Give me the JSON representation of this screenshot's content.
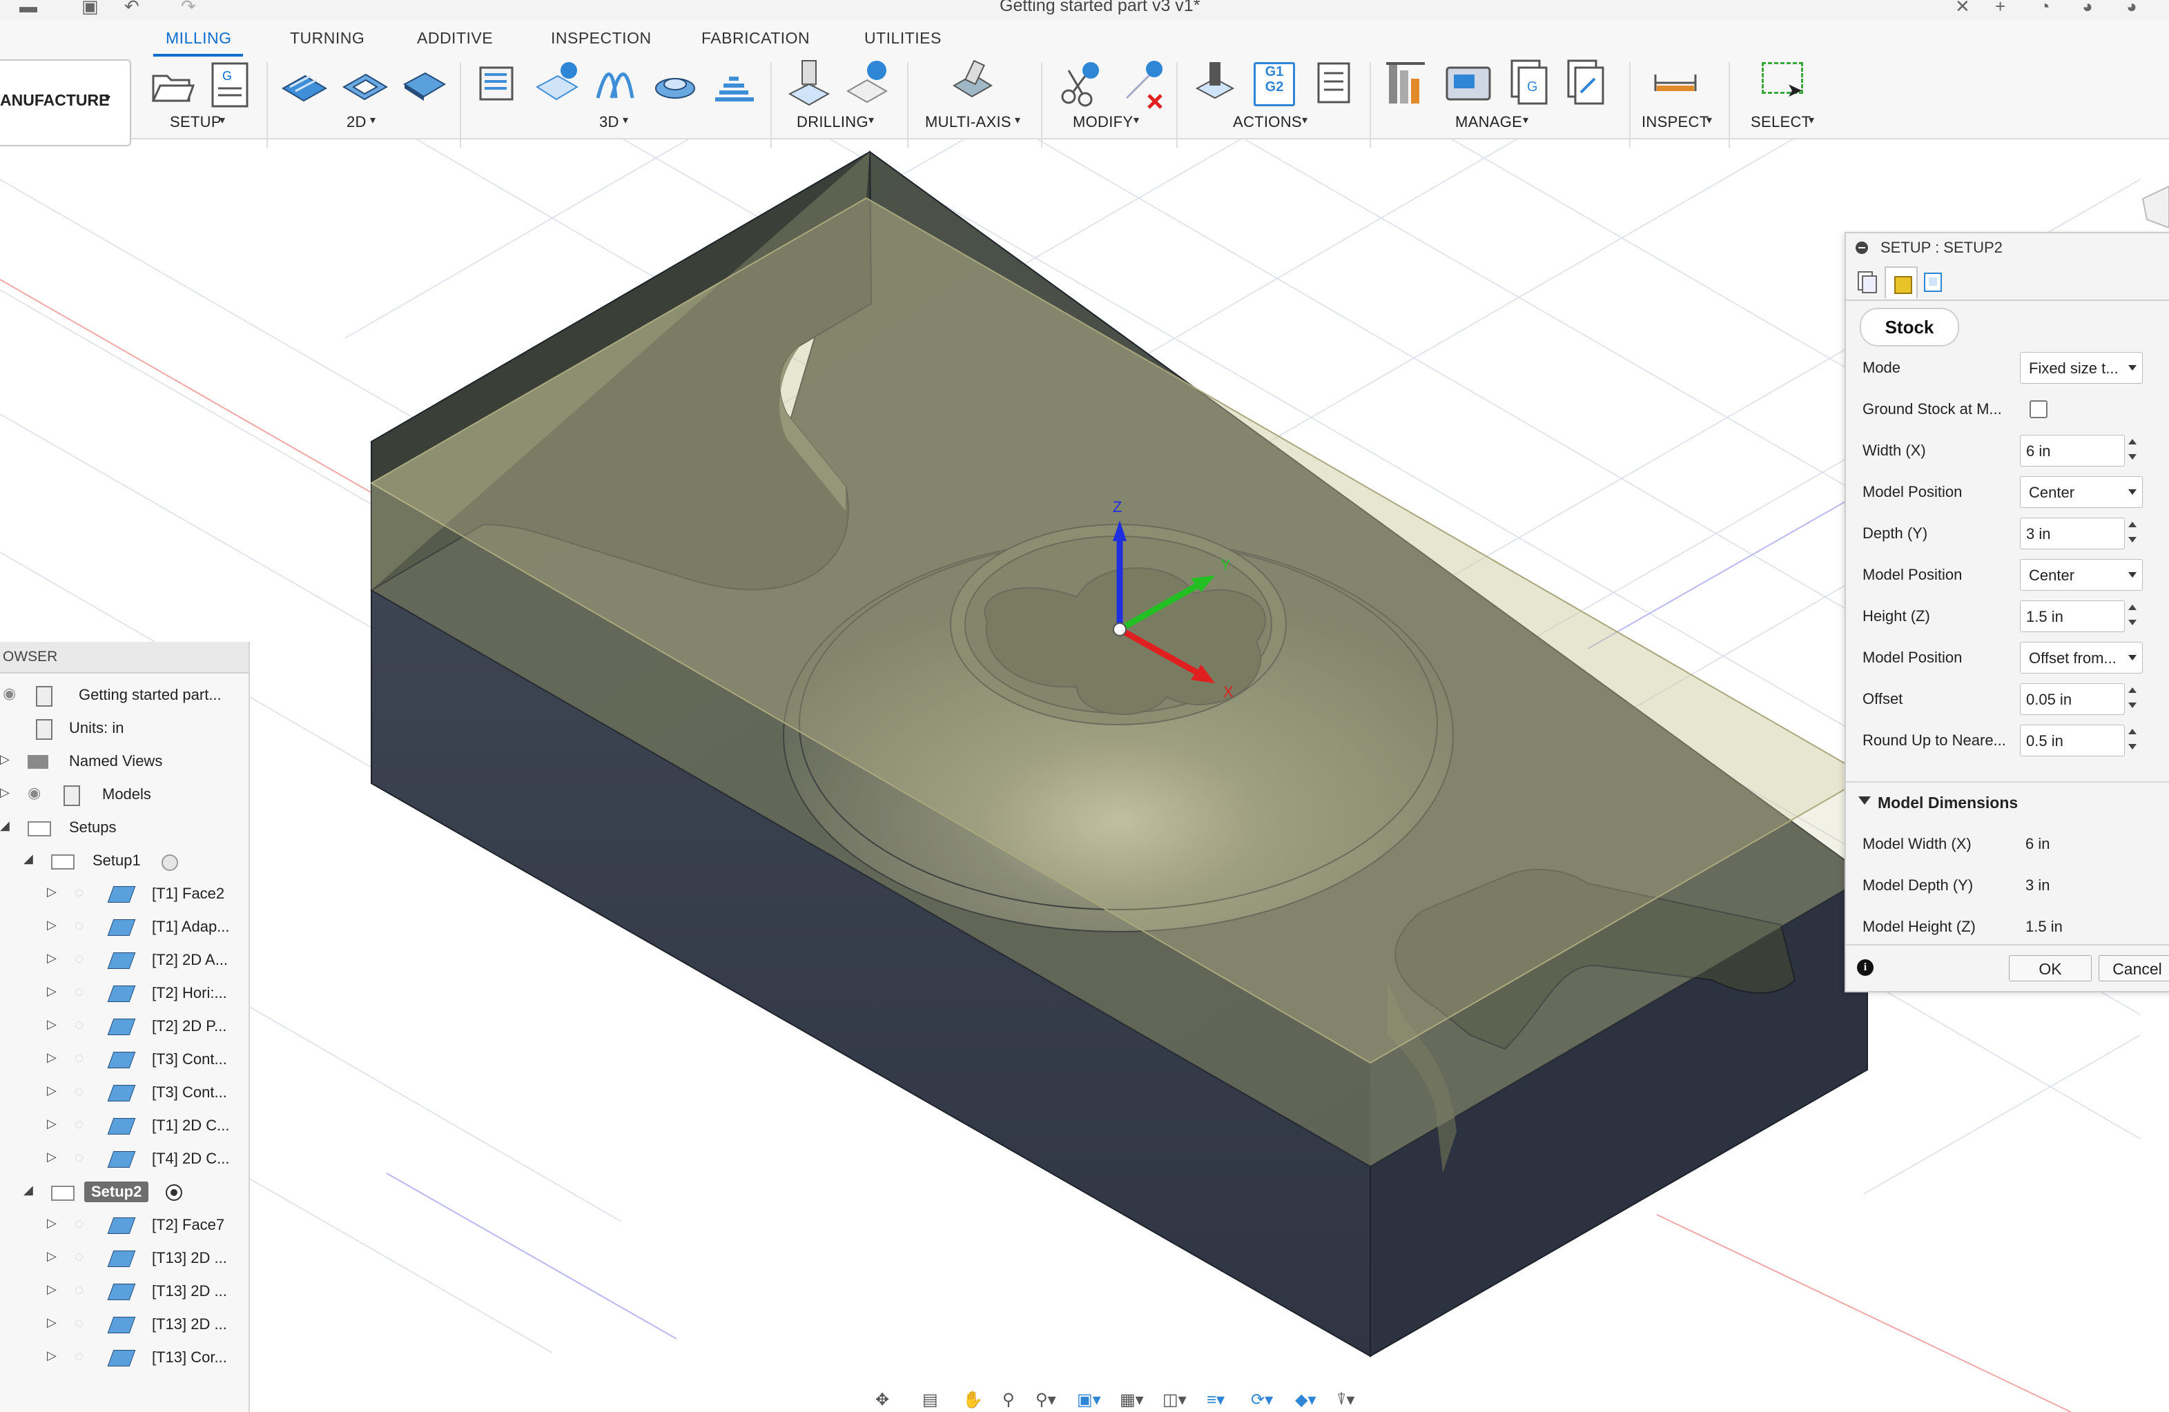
{
  "window": {
    "title": "Getting started part v3 v1*"
  },
  "ribbon": {
    "workspace": "ANUFACTURE",
    "tabs": [
      {
        "label": "MILLING",
        "active": true
      },
      {
        "label": "TURNING"
      },
      {
        "label": "ADDITIVE"
      },
      {
        "label": "INSPECTION"
      },
      {
        "label": "FABRICATION"
      },
      {
        "label": "UTILITIES"
      }
    ],
    "groups": [
      "SETUP",
      "2D",
      "3D",
      "DRILLING",
      "MULTI-AXIS",
      "MODIFY",
      "ACTIONS",
      "MANAGE",
      "INSPECT",
      "SELECT"
    ],
    "g1g2_icon_text": {
      "line1": "G1",
      "line2": "G2"
    }
  },
  "browser": {
    "title": "OWSER",
    "root": "Getting started part...",
    "units": "Units: in",
    "named_views": "Named Views",
    "models": "Models",
    "setups": "Setups",
    "setup1": {
      "label": "Setup1",
      "ops": [
        "[T1] Face2",
        "[T1] Adap...",
        "[T2] 2D A...",
        "[T2] Hori:...",
        "[T2] 2D P...",
        "[T3] Cont...",
        "[T3] Cont...",
        "[T1] 2D C...",
        "[T4] 2D C..."
      ]
    },
    "setup2": {
      "label": "Setup2",
      "ops": [
        "[T2] Face7",
        "[T13] 2D ...",
        "[T13] 2D ...",
        "[T13] 2D ...",
        "[T13] Cor..."
      ]
    }
  },
  "panel": {
    "title": "SETUP : SETUP2",
    "section_tab": "Stock",
    "fields": {
      "mode": {
        "label": "Mode",
        "value": "Fixed size t..."
      },
      "ground_stock": {
        "label": "Ground Stock at M...",
        "checked": false
      },
      "width": {
        "label": "Width (X)",
        "value": "6 in"
      },
      "width_position": {
        "label": "Model Position",
        "value": "Center"
      },
      "depth": {
        "label": "Depth (Y)",
        "value": "3 in"
      },
      "depth_position": {
        "label": "Model Position",
        "value": "Center"
      },
      "height": {
        "label": "Height (Z)",
        "value": "1.5 in"
      },
      "height_position": {
        "label": "Model Position",
        "value": "Offset from..."
      },
      "offset": {
        "label": "Offset",
        "value": "0.05 in"
      },
      "round_up": {
        "label": "Round Up to Neare...",
        "value": "0.5 in"
      }
    },
    "model_dimensions": {
      "title": "Model Dimensions",
      "width": {
        "label": "Model Width (X)",
        "value": "6 in"
      },
      "depth": {
        "label": "Model Depth (Y)",
        "value": "3 in"
      },
      "height": {
        "label": "Model Height (Z)",
        "value": "1.5 in"
      }
    },
    "ok": "OK",
    "cancel": "Cancel"
  },
  "viewport": {
    "axis_labels": {
      "x": "X",
      "y": "Y",
      "z": "Z"
    },
    "colors": {
      "stock_fill": "#c9c79a",
      "model_dark": "#3b4150",
      "axis_x": "#e02020",
      "axis_y": "#22c022",
      "axis_z": "#1f2fe0",
      "accent": "#0a6fd1"
    }
  }
}
